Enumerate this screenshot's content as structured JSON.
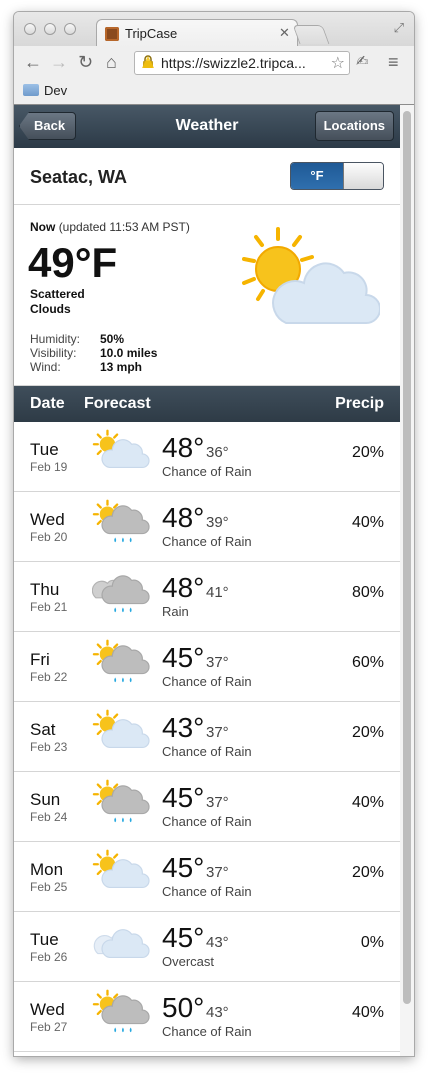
{
  "browser": {
    "tab_title": "TripCase",
    "url": "https://swizzle2.tripca...",
    "bookmark_folder": "Dev"
  },
  "header": {
    "back_label": "Back",
    "title": "Weather",
    "locations_label": "Locations"
  },
  "location": {
    "city": "Seatac, WA",
    "unit_toggle_label": "°F",
    "unit_toggle_state": "on"
  },
  "current": {
    "now_label": "Now",
    "updated_text": "(updated 11:53 AM PST)",
    "temperature": "49°F",
    "condition_line1": "Scattered",
    "condition_line2": "Clouds",
    "icon": "sun-cloud-icon",
    "humidity_label": "Humidity:",
    "humidity": "50%",
    "visibility_label": "Visibility:",
    "visibility": "10.0 miles",
    "wind_label": "Wind:",
    "wind": "13 mph"
  },
  "forecast": {
    "header": {
      "date": "Date",
      "forecast": "Forecast",
      "precip": "Precip"
    },
    "rows": [
      {
        "day": "Tue",
        "date": "Feb 19",
        "hi": "48°",
        "lo": "36°",
        "desc": "Chance of Rain",
        "precip": "20%",
        "icon": "sun-cloud-icon"
      },
      {
        "day": "Wed",
        "date": "Feb 20",
        "hi": "48°",
        "lo": "39°",
        "desc": "Chance of Rain",
        "precip": "40%",
        "icon": "sun-rain-cloud-icon"
      },
      {
        "day": "Thu",
        "date": "Feb 21",
        "hi": "48°",
        "lo": "41°",
        "desc": "Rain",
        "precip": "80%",
        "icon": "rain-cloud-icon"
      },
      {
        "day": "Fri",
        "date": "Feb 22",
        "hi": "45°",
        "lo": "37°",
        "desc": "Chance of Rain",
        "precip": "60%",
        "icon": "sun-rain-cloud-icon"
      },
      {
        "day": "Sat",
        "date": "Feb 23",
        "hi": "43°",
        "lo": "37°",
        "desc": "Chance of Rain",
        "precip": "20%",
        "icon": "sun-cloud-icon"
      },
      {
        "day": "Sun",
        "date": "Feb 24",
        "hi": "45°",
        "lo": "37°",
        "desc": "Chance of Rain",
        "precip": "40%",
        "icon": "sun-rain-cloud-icon"
      },
      {
        "day": "Mon",
        "date": "Feb 25",
        "hi": "45°",
        "lo": "37°",
        "desc": "Chance of Rain",
        "precip": "20%",
        "icon": "sun-cloud-icon"
      },
      {
        "day": "Tue",
        "date": "Feb 26",
        "hi": "45°",
        "lo": "43°",
        "desc": "Overcast",
        "precip": "0%",
        "icon": "overcast-icon"
      },
      {
        "day": "Wed",
        "date": "Feb 27",
        "hi": "50°",
        "lo": "43°",
        "desc": "Chance of Rain",
        "precip": "40%",
        "icon": "sun-rain-cloud-icon"
      }
    ]
  }
}
